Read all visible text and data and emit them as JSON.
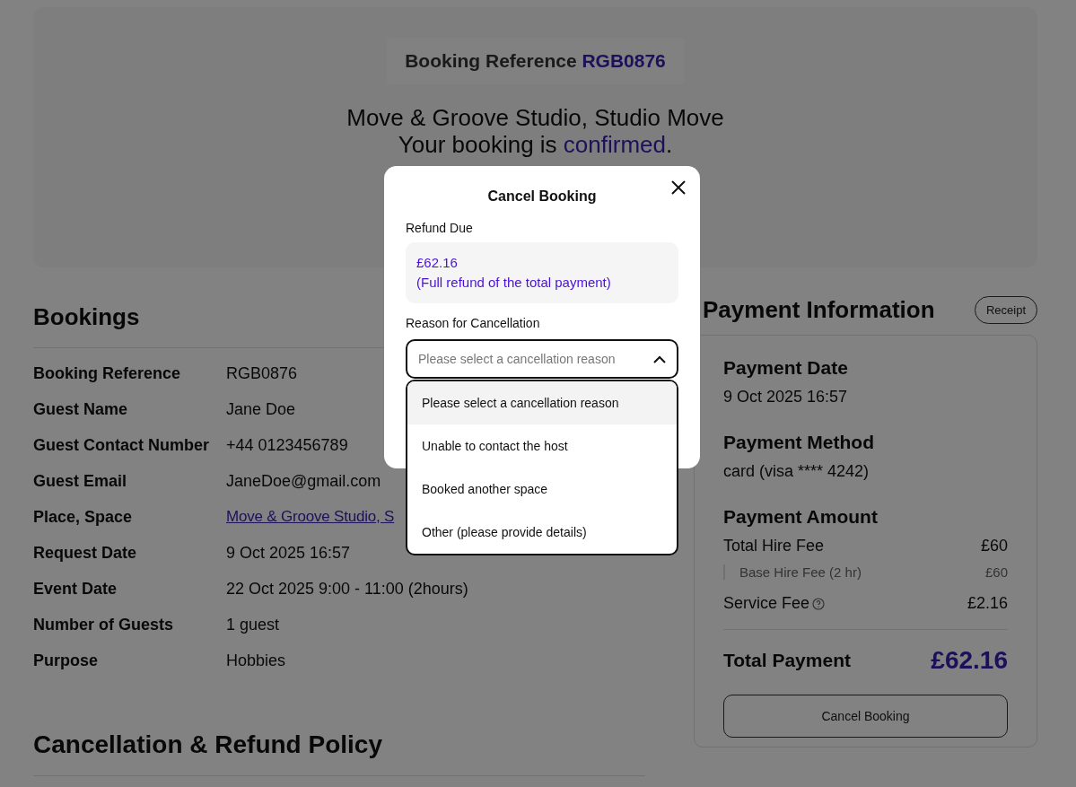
{
  "hero": {
    "reference_label": "Booking Reference",
    "reference": "RGB0876",
    "venue": "Move & Groove Studio, Studio Move",
    "status_before": "Your booking is ",
    "status_word": "confirmed",
    "status_after": "."
  },
  "bookings": {
    "title": "Bookings",
    "rows": [
      {
        "label": "Booking Reference",
        "value": "RGB0876",
        "kind": "text"
      },
      {
        "label": "Guest Name",
        "value": "Jane Doe",
        "kind": "text"
      },
      {
        "label": "Guest Contact Number",
        "value": "+44 0123456789",
        "kind": "text"
      },
      {
        "label": "Guest Email",
        "value": "JaneDoe@gmail.com",
        "kind": "text"
      },
      {
        "label": "Place, Space",
        "value": "Move & Groove Studio, S",
        "kind": "link"
      },
      {
        "label": "Request Date",
        "value": "9 Oct 2025 16:57",
        "kind": "text"
      },
      {
        "label": "Event Date",
        "value": "22 Oct 2025 9:00 - 11:00 (2hours)",
        "kind": "text"
      },
      {
        "label": "Number of Guests",
        "value": "1 guest",
        "kind": "text"
      },
      {
        "label": "Purpose",
        "value": "Hobbies",
        "kind": "text"
      }
    ]
  },
  "policy": {
    "title": "Cancellation & Refund Policy"
  },
  "payment": {
    "title": "Payment Information",
    "receipt_button": "Receipt",
    "date_title": "Payment Date",
    "date": "9 Oct 2025 16:57",
    "method_title": "Payment Method",
    "method": "card (visa **** 4242)",
    "amount_title": "Payment Amount",
    "lines": [
      {
        "label": "Total Hire Fee",
        "value": "£60",
        "kind": "main"
      },
      {
        "label": "Base Hire Fee (2 hr)",
        "value": "£60",
        "kind": "sub"
      },
      {
        "label": "Service Fee",
        "value": "£2.16",
        "kind": "help"
      }
    ],
    "total_label": "Total Payment",
    "total": "£62.16",
    "cancel_button": "Cancel Booking"
  },
  "modal": {
    "title": "Cancel Booking",
    "refund_label": "Refund Due",
    "refund_amount": "£62.16",
    "refund_note": "(Full refund of the total payment)",
    "reason_label": "Reason for Cancellation",
    "placeholder": "Please select a cancellation reason",
    "expanded": true,
    "options": [
      {
        "label": "Please select a cancellation reason",
        "selected": true
      },
      {
        "label": "Unable to contact the host",
        "selected": false
      },
      {
        "label": "Booked another space",
        "selected": false
      },
      {
        "label": "Other (please provide details)",
        "selected": false
      }
    ]
  }
}
